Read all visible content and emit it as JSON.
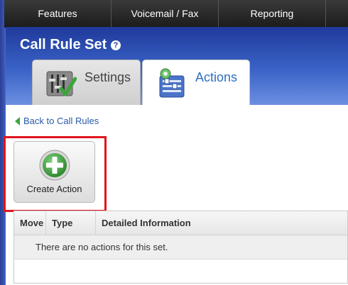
{
  "topnav": {
    "items": [
      "Features",
      "Voicemail / Fax",
      "Reporting",
      ""
    ]
  },
  "header": {
    "title": "Call Rule Set",
    "help_icon": "help-icon"
  },
  "tabs": [
    {
      "label": "Settings",
      "icon": "settings-sliders-icon",
      "active": false
    },
    {
      "label": "Actions",
      "icon": "actions-icon",
      "active": true
    }
  ],
  "content": {
    "back_link": "Back to Call Rules",
    "create_button": {
      "label": "Create Action",
      "icon": "plus-icon"
    },
    "table": {
      "columns": [
        "Move",
        "Type",
        "Detailed Information"
      ],
      "empty_message": "There are no actions for this set."
    }
  },
  "colors": {
    "nav_bg": "#222222",
    "header_blue": "#3a63c8",
    "active_tab_text": "#2e6fc5",
    "highlight": "#e0141e",
    "plus_green": "#3a9a3a"
  }
}
